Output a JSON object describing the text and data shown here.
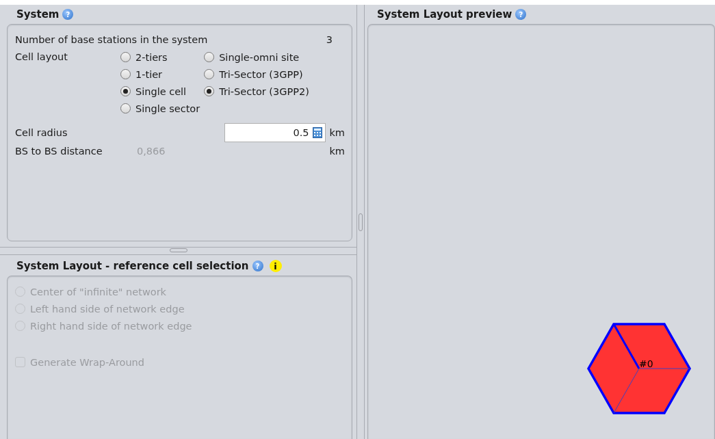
{
  "system": {
    "title": "System",
    "help": "?",
    "base_stations": {
      "label": "Number of base stations in the system",
      "value": "3"
    },
    "cell_layout": {
      "label": "Cell layout",
      "columns": [
        [
          {
            "label": "2-tiers",
            "selected": false
          },
          {
            "label": "1-tier",
            "selected": false
          },
          {
            "label": "Single cell",
            "selected": true
          },
          {
            "label": "Single sector",
            "selected": false
          }
        ],
        [
          {
            "label": "Single-omni site",
            "selected": false
          },
          {
            "label": "Tri-Sector (3GPP)",
            "selected": false
          },
          {
            "label": "Tri-Sector (3GPP2)",
            "selected": true
          }
        ]
      ]
    },
    "cell_radius": {
      "label": "Cell radius",
      "value": "0.5",
      "unit": "km"
    },
    "bs_distance": {
      "label": "BS to BS distance",
      "value": "0,866",
      "unit": "km",
      "disabled": true
    }
  },
  "reference": {
    "title": "System Layout - reference cell selection",
    "help": "?",
    "info": "i",
    "options": [
      {
        "label": "Center of \"infinite\" network",
        "selected": false,
        "disabled": true
      },
      {
        "label": "Left hand side of network edge",
        "selected": false,
        "disabled": true
      },
      {
        "label": "Right hand side of network edge",
        "selected": false,
        "disabled": true
      }
    ],
    "wrap_around": {
      "label": "Generate Wrap-Around",
      "checked": false,
      "disabled": true
    }
  },
  "preview": {
    "title": "System Layout preview",
    "help": "?",
    "cell_label": "#0"
  }
}
